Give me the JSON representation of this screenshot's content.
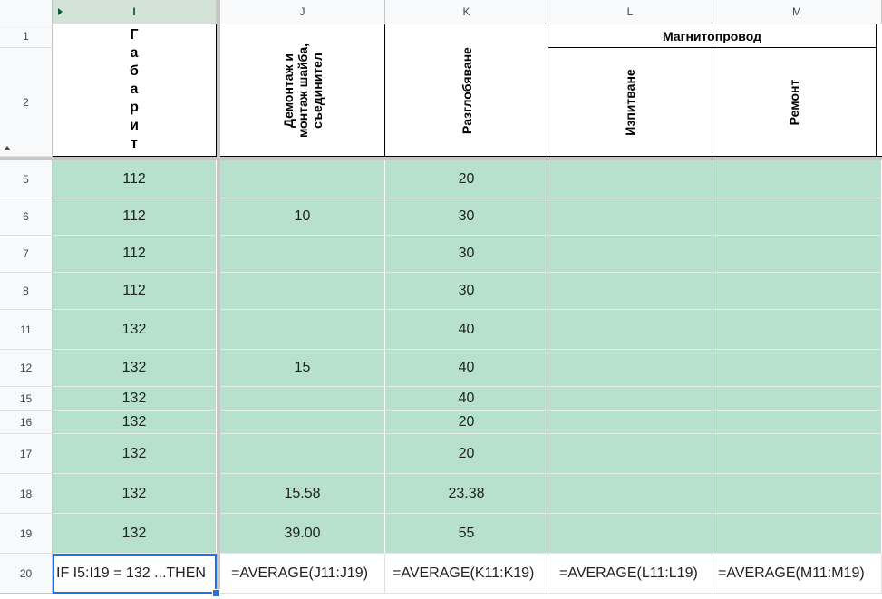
{
  "columns": [
    {
      "id": "I",
      "label": "I"
    },
    {
      "id": "J",
      "label": "J"
    },
    {
      "id": "K",
      "label": "K"
    },
    {
      "id": "L",
      "label": "L"
    },
    {
      "id": "M",
      "label": "M"
    }
  ],
  "header": {
    "gabarit_letters": [
      "Г",
      "а",
      "б",
      "а",
      "р",
      "и",
      "т"
    ],
    "col_j": "Демонтаж и\nмонтаж шайба,\nсъединител",
    "col_k": "Разглобяване",
    "group_lm": "Магнитопровод",
    "col_l": "Изпитване",
    "col_m": "Ремонт"
  },
  "row_labels": {
    "r1": "1",
    "r2": "2"
  },
  "rows": [
    {
      "num": "5",
      "I": "112",
      "J": "",
      "K": "20",
      "L": "",
      "M": ""
    },
    {
      "num": "6",
      "I": "112",
      "J": "10",
      "K": "30",
      "L": "",
      "M": ""
    },
    {
      "num": "7",
      "I": "112",
      "J": "",
      "K": "30",
      "L": "",
      "M": ""
    },
    {
      "num": "8",
      "I": "112",
      "J": "",
      "K": "30",
      "L": "",
      "M": ""
    },
    {
      "num": "11",
      "I": "132",
      "J": "",
      "K": "40",
      "L": "",
      "M": ""
    },
    {
      "num": "12",
      "I": "132",
      "J": "15",
      "K": "40",
      "L": "",
      "M": ""
    },
    {
      "num": "15",
      "I": "132",
      "J": "",
      "K": "40",
      "L": "",
      "M": ""
    },
    {
      "num": "16",
      "I": "132",
      "J": "",
      "K": "20",
      "L": "",
      "M": ""
    },
    {
      "num": "17",
      "I": "132",
      "J": "",
      "K": "20",
      "L": "",
      "M": ""
    },
    {
      "num": "18",
      "I": "132",
      "J": "15.58",
      "K": "23.38",
      "L": "",
      "M": ""
    },
    {
      "num": "19",
      "I": "132",
      "J": "39.00",
      "K": "55",
      "L": "",
      "M": ""
    }
  ],
  "formula_row": {
    "num": "20",
    "I": "IF I5:I19 = 132 ...THEN",
    "J": "=AVERAGE(J11:J19)",
    "K": "=AVERAGE(K11:K19)",
    "L": "=AVERAGE(L11:L19)",
    "M": "=AVERAGE(M11:M19)"
  },
  "colors": {
    "highlight": "#b7e1cd",
    "selection": "#1a73e8"
  }
}
